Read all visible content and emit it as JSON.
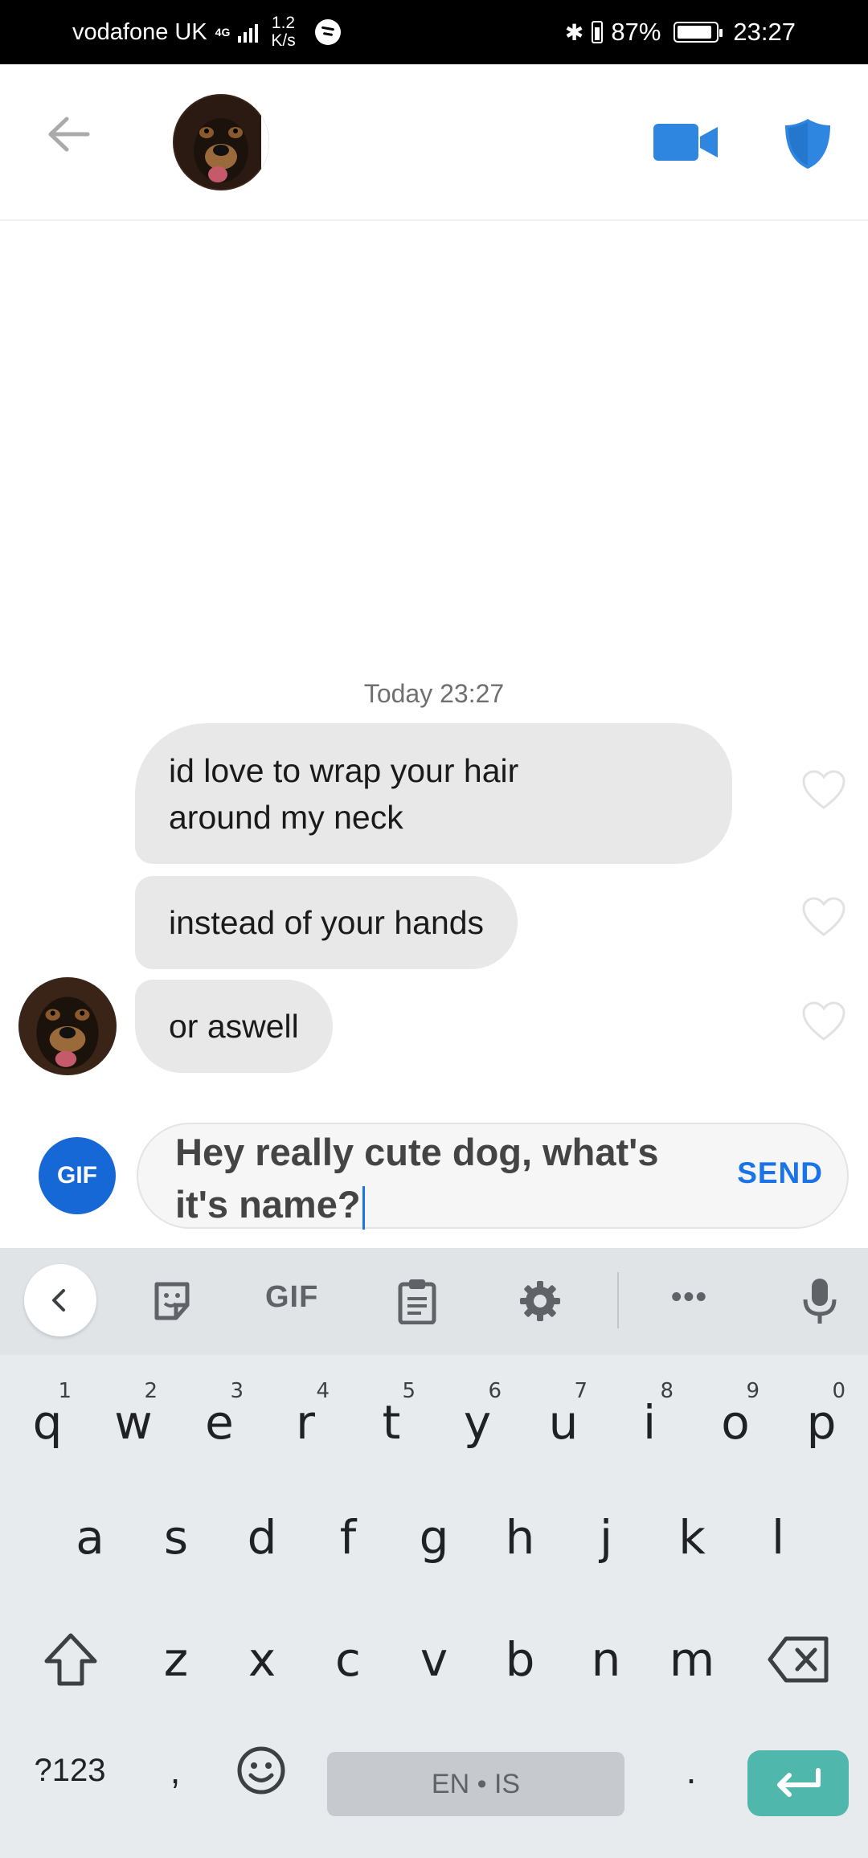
{
  "status_bar": {
    "carrier": "vodafone UK",
    "network": "4G",
    "speed_value": "1.2",
    "speed_unit": "K/s",
    "battery": "87%",
    "time": "23:27"
  },
  "header": {
    "back_icon": "arrow-left-icon",
    "video_icon": "video-camera-icon",
    "safety_icon": "shield-icon"
  },
  "conversation": {
    "timestamp": "Today 23:27",
    "messages": [
      {
        "text": "id love to wrap your hair around my neck",
        "liked": false
      },
      {
        "text": "instead of your hands",
        "liked": false
      },
      {
        "text": "or aswell",
        "liked": false
      }
    ]
  },
  "composer": {
    "gif_label": "GIF",
    "draft": "Hey really cute dog, what's it's name?",
    "send_label": "SEND"
  },
  "keyboard": {
    "toolbar_gif": "GIF",
    "toolbar_more": "•••",
    "row1": [
      "q",
      "w",
      "e",
      "r",
      "t",
      "y",
      "u",
      "i",
      "o",
      "p"
    ],
    "row1_hints": [
      "1",
      "2",
      "3",
      "4",
      "5",
      "6",
      "7",
      "8",
      "9",
      "0"
    ],
    "row2": [
      "a",
      "s",
      "d",
      "f",
      "g",
      "h",
      "j",
      "k",
      "l"
    ],
    "row3": [
      "z",
      "x",
      "c",
      "v",
      "b",
      "n",
      "m"
    ],
    "symbols_label": "?123",
    "comma": ",",
    "space_label": "EN • IS",
    "period": ".",
    "colors": {
      "enter": "#4fb7ab",
      "accent": "#1a73e8",
      "gif_button": "#1668d6"
    }
  }
}
